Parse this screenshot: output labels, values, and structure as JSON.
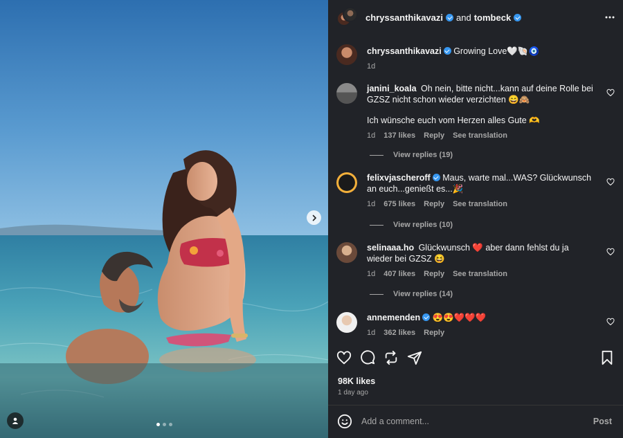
{
  "header": {
    "user1": "chryssanthikavazi",
    "and_text": "and",
    "user2": "tombeck"
  },
  "caption": {
    "user": "chryssanthikavazi",
    "text": "Growing Love🤍🐚🧿",
    "time": "1d"
  },
  "comments": [
    {
      "user": "janini_koala",
      "verified": false,
      "text": "Oh nein, bitte nicht...kann auf deine Rolle bei GZSZ nicht schon wieder verzichten 😄🙈",
      "text2": "Ich wünsche euch vom Herzen alles Gute 🫶",
      "time": "1d",
      "likes": "137 likes",
      "reply": "Reply",
      "translate": "See translation",
      "view_replies": "View replies (19)"
    },
    {
      "user": "felixvjascheroff",
      "verified": true,
      "text": "Maus, warte mal...WAS? Glückwunsch an euch...genießt es...🎉",
      "time": "1d",
      "likes": "675 likes",
      "reply": "Reply",
      "translate": "See translation",
      "view_replies": "View replies (10)"
    },
    {
      "user": "selinaaa.ho",
      "verified": false,
      "text": "Glückwunsch ❤️ aber dann fehlst du ja wieder bei GZSZ 😆",
      "time": "1d",
      "likes": "407 likes",
      "reply": "Reply",
      "translate": "See translation",
      "view_replies": "View replies (14)"
    },
    {
      "user": "annemenden",
      "verified": true,
      "text": "😍😍❤️❤️❤️",
      "time": "1d",
      "likes": "362 likes",
      "reply": "Reply"
    }
  ],
  "post": {
    "likes": "98K likes",
    "posted": "1 day ago"
  },
  "composer": {
    "placeholder": "Add a comment...",
    "post_label": "Post"
  },
  "icons": {
    "more": "more-options-icon",
    "next": "chevron-right-icon",
    "tag": "user-tag-icon",
    "like": "heart-icon",
    "comment": "comment-icon",
    "repost": "repost-icon",
    "share": "share-icon",
    "save": "bookmark-icon",
    "emoji": "emoji-icon"
  },
  "carousel": {
    "total": 3,
    "current": 1
  },
  "colors": {
    "panel": "#212328",
    "accent": "#3797f0",
    "muted": "#a8a8a8"
  }
}
